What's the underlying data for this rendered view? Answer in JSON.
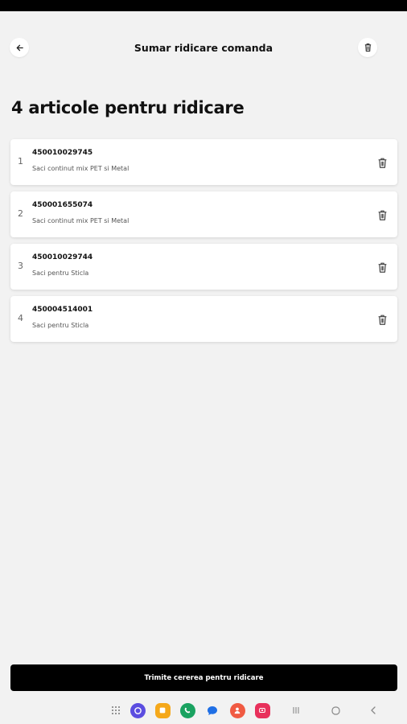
{
  "header": {
    "title": "Sumar ridicare comanda",
    "back_icon": "arrow-left-icon",
    "delete_icon": "trash-icon"
  },
  "main": {
    "title": "4 articole pentru ridicare",
    "items": [
      {
        "index": "1",
        "code": "450010029745",
        "description": "Saci continut mix PET si Metal"
      },
      {
        "index": "2",
        "code": "450001655074",
        "description": "Saci continut mix PET si Metal"
      },
      {
        "index": "3",
        "code": "450010029744",
        "description": "Saci pentru Sticla"
      },
      {
        "index": "4",
        "code": "450004514001",
        "description": "Saci pentru Sticla"
      }
    ]
  },
  "footer": {
    "submit_label": "Trimite cererea pentru ridicare"
  },
  "nav_bar": {
    "apps": [
      {
        "name": "app-drawer-icon"
      },
      {
        "name": "internet-app-icon",
        "color": "#5b4de0"
      },
      {
        "name": "notes-app-icon",
        "color": "#f5a81a"
      },
      {
        "name": "phone-app-icon",
        "color": "#1aa260"
      },
      {
        "name": "messages-app-icon",
        "color": "#1f6fe5"
      },
      {
        "name": "contacts-app-icon",
        "color": "#f05a42"
      },
      {
        "name": "screen-recorder-app-icon",
        "color": "#e8305b"
      }
    ],
    "recents_icon": "recents-icon",
    "home_icon": "home-icon",
    "back_icon": "nav-back-icon"
  },
  "colors": {
    "background": "#f2f2f2",
    "card": "#ffffff",
    "primary_button": "#000000"
  }
}
